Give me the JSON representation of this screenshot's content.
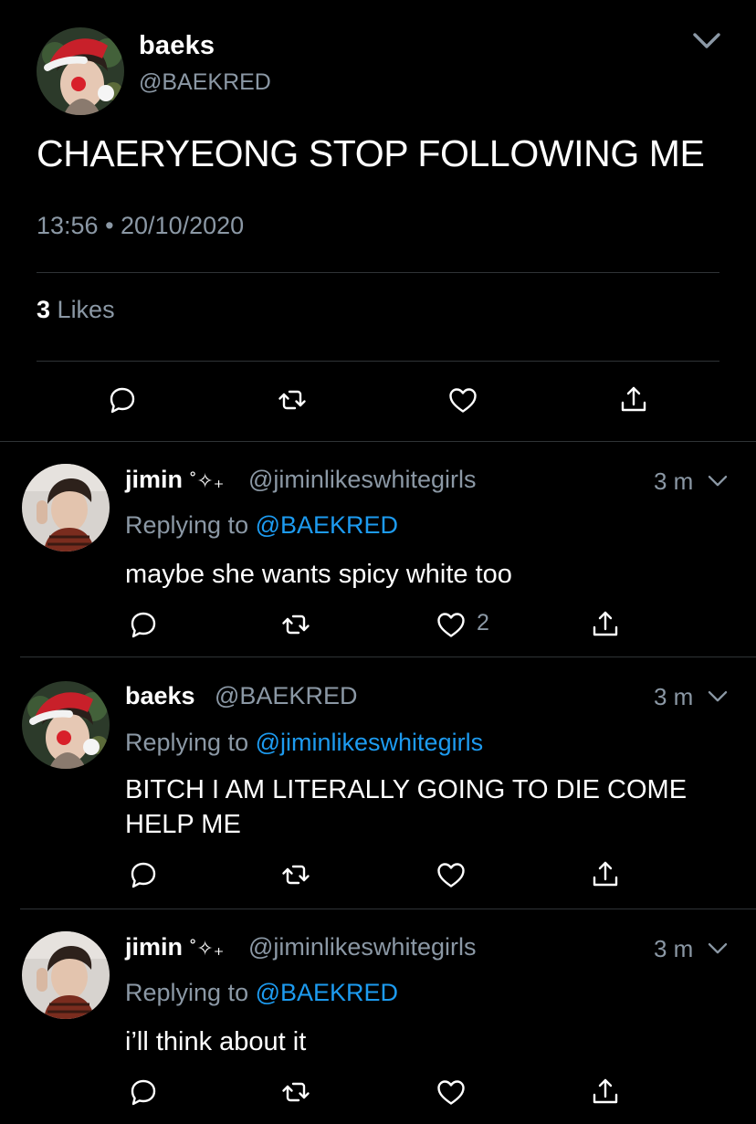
{
  "main_tweet": {
    "author_name": "baeks",
    "author_handle": "@BAEKRED",
    "text": "CHAERYEONG STOP FOLLOWING ME",
    "timestamp": "13:56 • 20/10/2020",
    "likes_count": "3",
    "likes_label": "Likes"
  },
  "replies": [
    {
      "name": "jimin",
      "name_deco": "˚✧₊",
      "handle": "@jiminlikeswhitegirls",
      "time": "3 m",
      "replying_prefix": "Replying to",
      "replying_to": "@BAEKRED",
      "text": "maybe she wants spicy white too",
      "like_count": "2"
    },
    {
      "name": "baeks",
      "name_deco": "",
      "handle": "@BAEKRED",
      "time": "3 m",
      "replying_prefix": "Replying to",
      "replying_to": "@jiminlikeswhitegirls",
      "text": "BITCH I AM LITERALLY GOING TO DIE COME HELP ME",
      "like_count": ""
    },
    {
      "name": "jimin",
      "name_deco": "˚✧₊",
      "handle": "@jiminlikeswhitegirls",
      "time": "3 m",
      "replying_prefix": "Replying to",
      "replying_to": "@BAEKRED",
      "text": "i’ll think about it",
      "like_count": ""
    }
  ],
  "colors": {
    "background": "#000000",
    "text_primary": "#ffffff",
    "text_secondary": "#8b98a5",
    "mention": "#1d9bf0",
    "divider": "#2f3336"
  },
  "icons": [
    "reply-icon",
    "retweet-icon",
    "like-icon",
    "share-icon",
    "chevron-down-icon"
  ]
}
